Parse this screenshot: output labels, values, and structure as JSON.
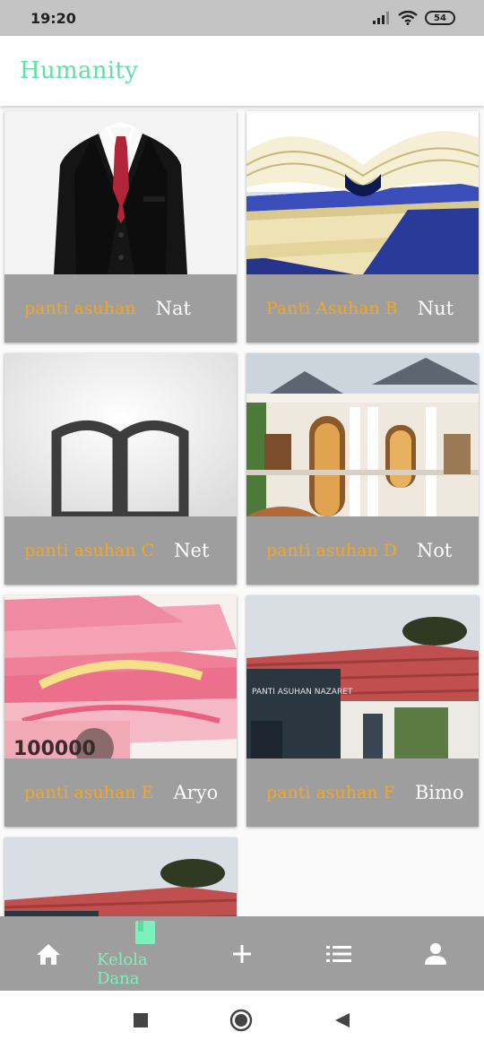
{
  "status_bar": {
    "time": "19:20",
    "battery": "54"
  },
  "app_bar": {
    "title": "Humanity"
  },
  "cards": [
    {
      "name": "panti asuhan",
      "sub": "Nat",
      "image": "suit-image"
    },
    {
      "name": "Panti Asuhan B",
      "sub": "Nut",
      "image": "book-image"
    },
    {
      "name": "panti asuhan C",
      "sub": "Net",
      "image": "open-book-icon-image"
    },
    {
      "name": "panti asuhan D",
      "sub": "Not",
      "image": "mansion-image"
    },
    {
      "name": "panti asuhan E",
      "sub": "Aryo",
      "image": "money-image",
      "money_text": "100000"
    },
    {
      "name": "panti asuhan F",
      "sub": "Bimo",
      "image": "building-image",
      "sign_text": "PANTI ASUHAN NAZARET"
    },
    {
      "name": "",
      "sub": "",
      "image": "building-image"
    }
  ],
  "bottom_nav": {
    "items": [
      {
        "icon": "home-icon",
        "label": ""
      },
      {
        "icon": "book-icon",
        "label": "Kelola Dana",
        "active": true
      },
      {
        "icon": "plus-icon",
        "label": ""
      },
      {
        "icon": "list-icon",
        "label": ""
      },
      {
        "icon": "person-icon",
        "label": ""
      }
    ]
  },
  "colors": {
    "accent": "#5fe0a8",
    "card_caption": "#f5a623",
    "nav_bg": "#9e9e9e"
  }
}
